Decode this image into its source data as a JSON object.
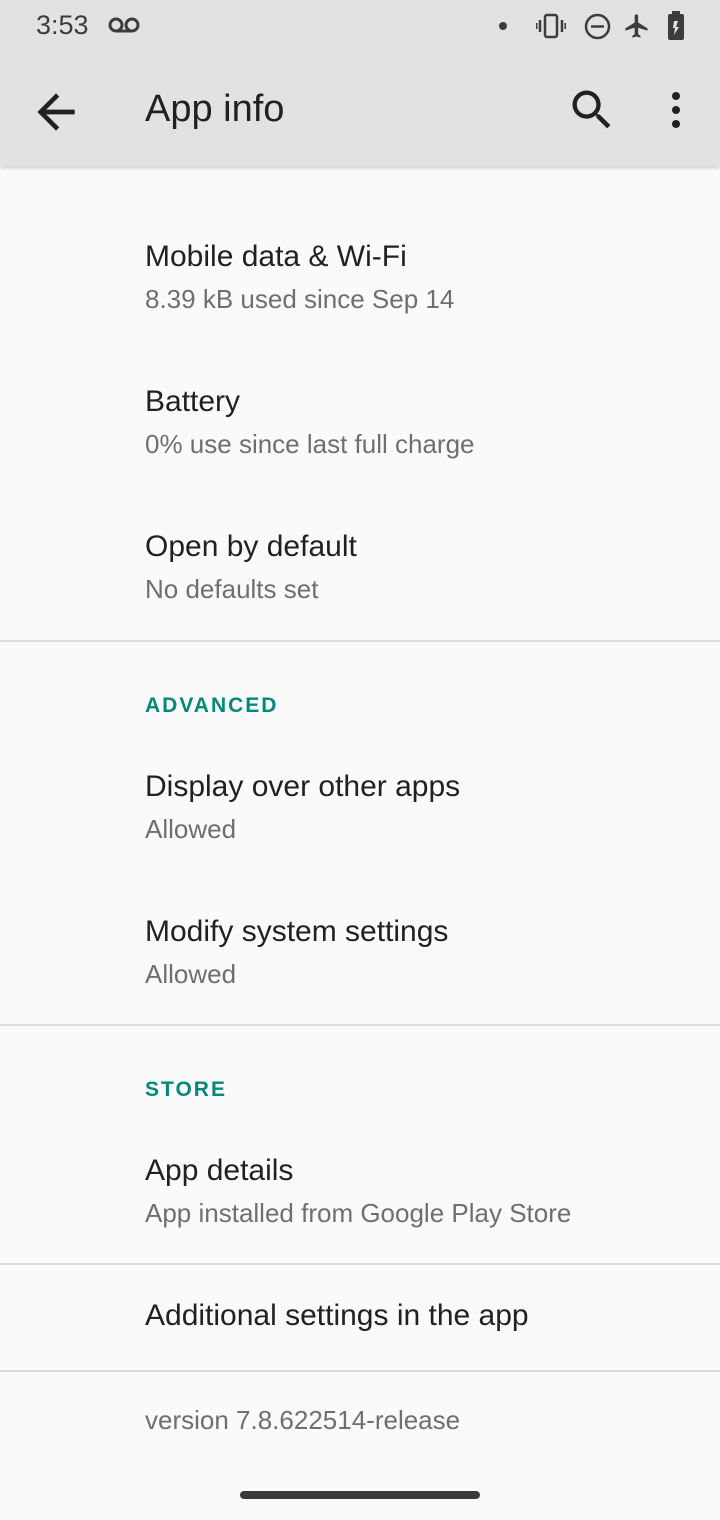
{
  "status_bar": {
    "time": "3:53",
    "icons": [
      "voicemail-icon",
      "dot-icon",
      "vibrate-icon",
      "do-not-disturb-icon",
      "airplane-icon",
      "battery-icon"
    ]
  },
  "app_bar": {
    "title": "App info",
    "icons": [
      "back-arrow-icon",
      "search-icon",
      "more-vert-icon"
    ]
  },
  "items": {
    "mobile_data": {
      "title": "Mobile data & Wi-Fi",
      "subtitle": "8.39 kB used since Sep 14"
    },
    "battery": {
      "title": "Battery",
      "subtitle": "0% use since last full charge"
    },
    "open_default": {
      "title": "Open by default",
      "subtitle": "No defaults set"
    },
    "display_over": {
      "title": "Display over other apps",
      "subtitle": "Allowed"
    },
    "modify_settings": {
      "title": "Modify system settings",
      "subtitle": "Allowed"
    },
    "app_details": {
      "title": "App details",
      "subtitle": "App installed from Google Play Store"
    },
    "additional": {
      "title": "Additional settings in the app"
    }
  },
  "sections": {
    "advanced": "ADVANCED",
    "store": "STORE"
  },
  "version": "version 7.8.622514-release",
  "colors": {
    "accent": "#00897b",
    "app_bar_bg": "#e2e2e2",
    "page_bg": "#fafafa"
  }
}
